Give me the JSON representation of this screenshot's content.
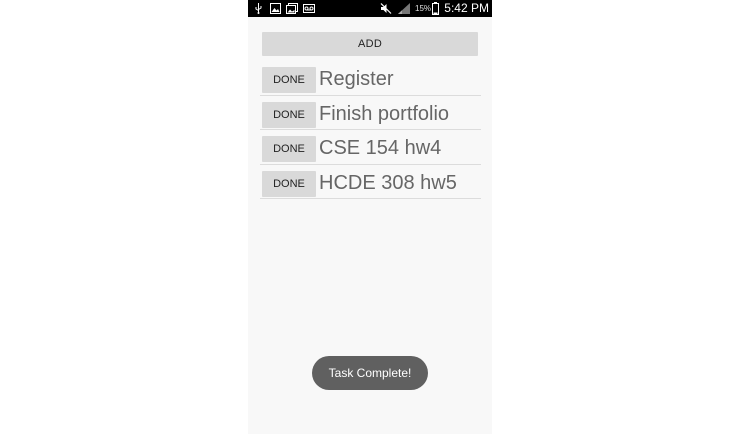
{
  "status_bar": {
    "icons": [
      "usb-icon",
      "gallery-icon",
      "photo-icon",
      "voicemail-icon",
      "mute-icon",
      "signal-icon",
      "battery-icon"
    ],
    "battery_percent": "15%",
    "time": "5:42 PM"
  },
  "app": {
    "add_label": "ADD",
    "tasks": [
      {
        "done_label": "DONE",
        "title": "Register"
      },
      {
        "done_label": "DONE",
        "title": "Finish portfolio"
      },
      {
        "done_label": "DONE",
        "title": "CSE 154 hw4"
      },
      {
        "done_label": "DONE",
        "title": "HCDE 308 hw5"
      }
    ],
    "toast": "Task Complete!"
  },
  "colors": {
    "status_bar_bg": "#000000",
    "app_bg": "#f8f8f8",
    "button_bg": "#d9d9d9",
    "task_text": "#666666",
    "toast_bg": "#606060"
  }
}
